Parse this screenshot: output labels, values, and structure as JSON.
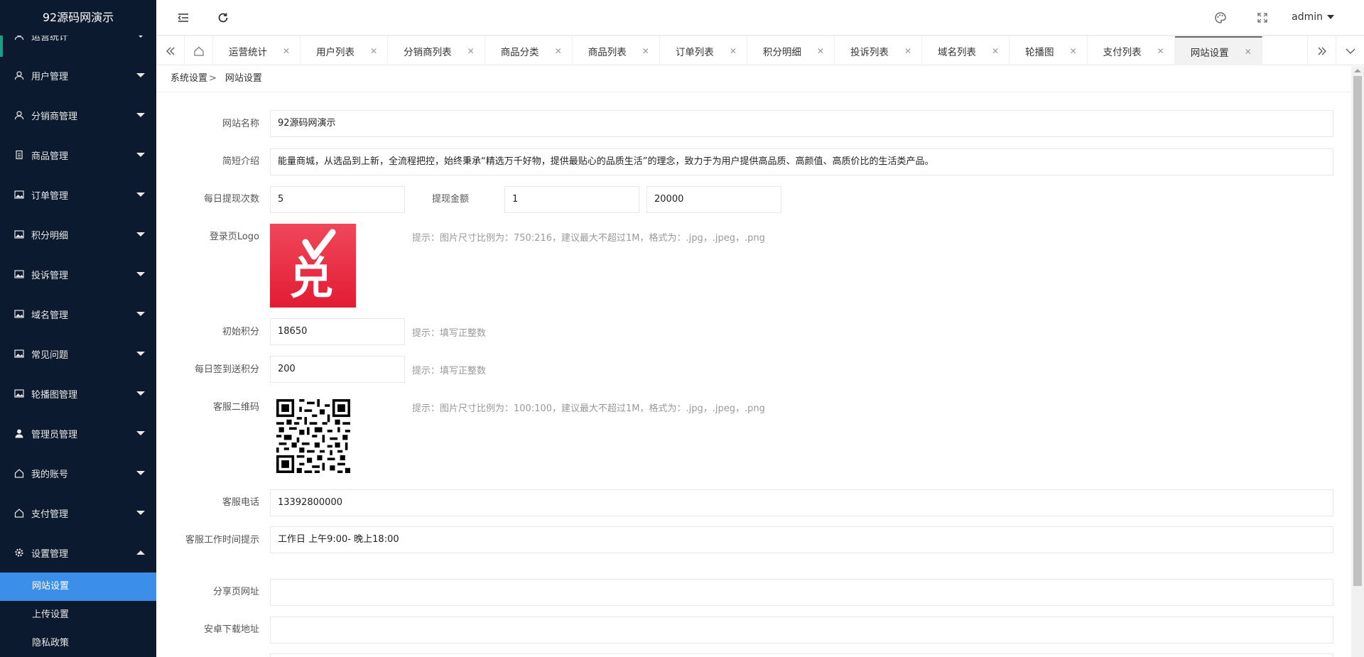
{
  "sidebar": {
    "title": "92源码网演示",
    "items": [
      {
        "label": "运营统计",
        "icon": "user-icon"
      },
      {
        "label": "用户管理",
        "icon": "user-icon"
      },
      {
        "label": "分销商管理",
        "icon": "user-icon"
      },
      {
        "label": "商品管理",
        "icon": "document-icon"
      },
      {
        "label": "订单管理",
        "icon": "image-icon"
      },
      {
        "label": "积分明细",
        "icon": "image-icon"
      },
      {
        "label": "投诉管理",
        "icon": "image-icon"
      },
      {
        "label": "域名管理",
        "icon": "image-icon"
      },
      {
        "label": "常见问题",
        "icon": "image-icon"
      },
      {
        "label": "轮播图管理",
        "icon": "image-icon"
      },
      {
        "label": "管理员管理",
        "icon": "person-icon"
      },
      {
        "label": "我的账号",
        "icon": "home-icon"
      },
      {
        "label": "支付管理",
        "icon": "home-icon"
      },
      {
        "label": "设置管理",
        "icon": "gear-icon"
      }
    ],
    "sub_items": [
      "网站设置",
      "上传设置",
      "隐私政策"
    ]
  },
  "header": {
    "user": "admin"
  },
  "tabs": [
    "运营统计",
    "用户列表",
    "分销商列表",
    "商品分类",
    "商品列表",
    "订单列表",
    "积分明细",
    "投诉列表",
    "域名列表",
    "轮播图",
    "支付列表",
    "网站设置"
  ],
  "breadcrumb": {
    "parent": "系统设置",
    "sep": ">",
    "current": "网站设置"
  },
  "form": {
    "site_name_label": "网站名称",
    "site_name": "92源码网演示",
    "intro_label": "简短介绍",
    "intro": "能量商城，从选品到上新，全流程把控，始终秉承“精选万千好物，提供最贴心的品质生活”的理念，致力于为用户提供高品质、高颜值、高质价比的生活类产品。",
    "daily_withdraw_label": "每日提现次数",
    "daily_withdraw": "5",
    "withdraw_amount_label": "提现金额",
    "withdraw_min": "1",
    "withdraw_max": "20000",
    "login_logo_label": "登录页Logo",
    "login_logo_hint": "提示：图片尺寸比例为：750:216，建议最大不超过1M，格式为：.jpg，.jpeg，.png",
    "logo_glyph": "兑",
    "init_points_label": "初始积分",
    "init_points": "18650",
    "init_points_hint": "提示：填写正整数",
    "signin_points_label": "每日签到送积分",
    "signin_points": "200",
    "signin_points_hint": "提示：填写正整数",
    "qr_label": "客服二维码",
    "qr_hint": "提示：图片尺寸比例为：100:100，建议最大不超过1M，格式为：.jpg，.jpeg，.png",
    "phone_label": "客服电话",
    "phone": "13392800000",
    "work_time_label": "客服工作时间提示",
    "work_time": "工作日 上午9:00- 晚上18:00",
    "share_url_label": "分享页网址",
    "share_url": "",
    "android_url_label": "安卓下载地址",
    "android_url": ""
  },
  "colors": {
    "sidebar_bg": "#0b1a2e",
    "active_blue": "#3b8fe8",
    "logo_red": "#e21c34"
  }
}
